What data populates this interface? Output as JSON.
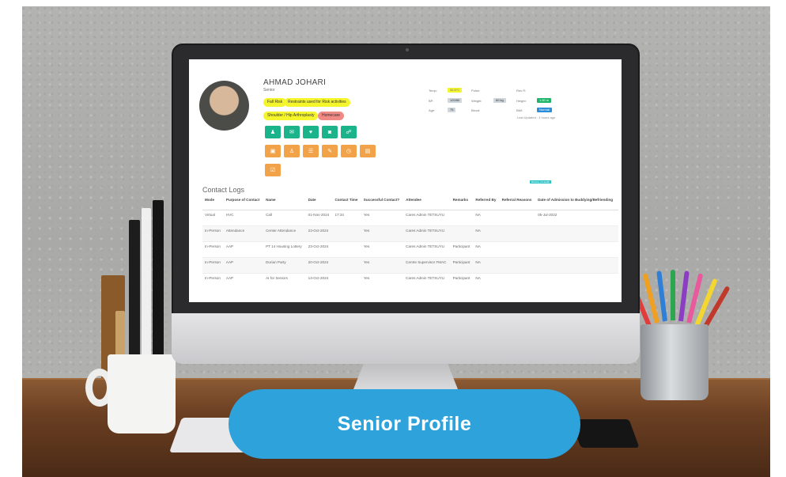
{
  "banner": {
    "label": "Senior Profile"
  },
  "profile": {
    "name": "AHMAD JOHARI",
    "role": "Senior",
    "tags": [
      {
        "label": "Fall Risk",
        "color": "#f5f52c"
      },
      {
        "label": "Restraints used for Risk activities",
        "color": "#f5f52c"
      },
      {
        "label": "Shoulder / Hip Arthroplasty",
        "color": "#f5f52c"
      },
      {
        "label": "Homecare",
        "color": "#ef8a85"
      }
    ],
    "action_icons_row1": [
      "person-icon",
      "chat-icon",
      "heart-icon",
      "camera-icon",
      "stethoscope-icon"
    ],
    "action_icons_row2": [
      "shirt-icon",
      "user-add-icon",
      "list-icon",
      "pencil-icon",
      "clock-icon",
      "document-icon"
    ],
    "action_icons_row3": [
      "checklist-icon"
    ]
  },
  "vitals": {
    "labels": {
      "temp": "Temp:",
      "pulse": "Pulse:",
      "resp": "Res R:",
      "bp": "BP:",
      "weight": "Weight:",
      "height": "Height:",
      "age": "Age:",
      "blood": "Blood:",
      "bmi": "BMI:"
    },
    "values": {
      "temp": "36.8°C",
      "bp": "120/80",
      "weight": "60 kg",
      "height": "1.60 m",
      "age": "75",
      "bmi": "Normal"
    },
    "last_updated": "Last Updated : 3 hours ago",
    "bar_label": "Ministry of Health"
  },
  "contact_logs": {
    "title": "Contact Logs",
    "columns": [
      "Mode",
      "Purpose of Contact",
      "Name",
      "Date",
      "Contact Time",
      "Successful Contact?",
      "Attendee",
      "Remarks",
      "Referred By",
      "Referral Reasons",
      "Date of Admission to Buddying/Befriending"
    ],
    "rows": [
      [
        "Virtual",
        "HVC",
        "Call",
        "01-Nov-2024",
        "17:34",
        "Yes",
        "Cares Admin TETSUYU",
        "",
        "NA",
        "",
        "05-Jul-2022"
      ],
      [
        "In-Person",
        "Attendance",
        "Center Attendance",
        "23-Oct-2024",
        "",
        "Yes",
        "Cares Admin TETSUYU",
        "",
        "NA",
        "",
        ""
      ],
      [
        "In-Person",
        "AAP",
        "PT 14 Housing Lottery",
        "23-Oct-2024",
        "",
        "Yes",
        "Cares Admin TETSUYU",
        "Participant",
        "NA",
        "",
        ""
      ],
      [
        "In-Person",
        "AAP",
        "Durian Party",
        "20-Oct-2024",
        "",
        "Yes",
        "Centre Supervisor FMAC",
        "Participant",
        "NA",
        "",
        ""
      ],
      [
        "In-Person",
        "AAP",
        "AI for Seniors",
        "14-Oct-2024",
        "",
        "Yes",
        "Cares Admin TETSUYU",
        "Participant",
        "NA",
        "",
        ""
      ]
    ]
  }
}
